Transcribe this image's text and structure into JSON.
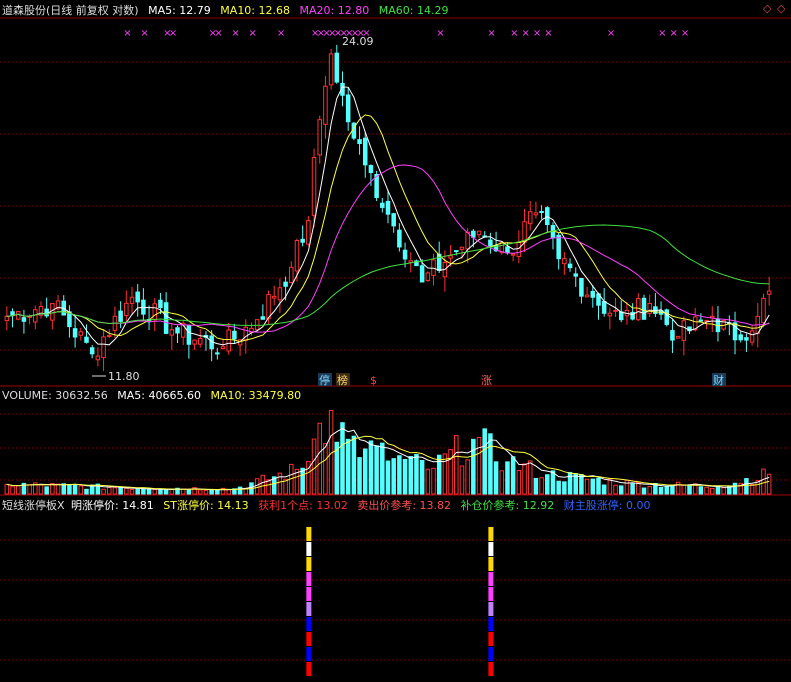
{
  "price_panel": {
    "stock_title": "道森股份(日线 前复权 对数)",
    "ma5_label": "MA5: 12.79",
    "ma10_label": "MA10: 12.68",
    "ma20_label": "MA20: 12.80",
    "ma60_label": "MA60: 14.29",
    "high_label": "24.09",
    "low_label": "11.80",
    "event_labels": [
      "停",
      "榜",
      "$",
      "涨",
      "财"
    ]
  },
  "volume_panel": {
    "volume_label": "VOLUME: 30632.56",
    "ma5_label": "MA5: 40665.60",
    "ma10_label": "MA10: 33479.80"
  },
  "indicator_panel": {
    "name_label": "短线涨停板X",
    "limit_up_label": "明涨停价: 14.81",
    "st_limit_label": "ST涨停价: 14.13",
    "profit_label": "获利1个点: 13.02",
    "sell_label": "卖出价参考: 13.82",
    "add_label": "补仓价参考: 12.92",
    "main_label": "财主股涨停: 0.00"
  },
  "controls": {
    "diamond_glyph": "◇",
    "close_glyph": "◇"
  },
  "colors": {
    "up": "#ff3030",
    "down": "#54ffff",
    "ma5": "#ffffff",
    "ma10": "#ffff40",
    "ma20": "#ff40ff",
    "ma60": "#40e040",
    "grid": "#8b0000",
    "text": "#dddddd"
  },
  "chart_data": {
    "type": "candlestick",
    "x_count": 135,
    "price_range": [
      11.3,
      25.5
    ],
    "price_scale": "log",
    "candles_key_points": [
      {
        "i": 0,
        "close": 12.9
      },
      {
        "i": 8,
        "close": 13.3
      },
      {
        "i": 15,
        "close": 11.8
      },
      {
        "i": 22,
        "close": 13.5
      },
      {
        "i": 30,
        "close": 12.4
      },
      {
        "i": 38,
        "close": 12.0
      },
      {
        "i": 44,
        "close": 12.8
      },
      {
        "i": 50,
        "close": 14.5
      },
      {
        "i": 53,
        "close": 16.2
      },
      {
        "i": 55,
        "close": 20.6
      },
      {
        "i": 57,
        "close": 24.09
      },
      {
        "i": 60,
        "close": 20.5
      },
      {
        "i": 63,
        "close": 18.5
      },
      {
        "i": 68,
        "close": 16.0
      },
      {
        "i": 73,
        "close": 14.0
      },
      {
        "i": 78,
        "close": 14.9
      },
      {
        "i": 83,
        "close": 15.8
      },
      {
        "i": 88,
        "close": 15.0
      },
      {
        "i": 93,
        "close": 16.5
      },
      {
        "i": 97,
        "close": 14.8
      },
      {
        "i": 103,
        "close": 13.5
      },
      {
        "i": 108,
        "close": 12.8
      },
      {
        "i": 113,
        "close": 13.3
      },
      {
        "i": 118,
        "close": 12.3
      },
      {
        "i": 124,
        "close": 12.9
      },
      {
        "i": 128,
        "close": 12.2
      },
      {
        "i": 132,
        "close": 12.9
      },
      {
        "i": 134,
        "close": 13.7
      }
    ],
    "volume_range": [
      0,
      140000
    ],
    "volume_key_points": [
      {
        "i": 0,
        "v": 15000
      },
      {
        "i": 20,
        "v": 10000
      },
      {
        "i": 40,
        "v": 8000
      },
      {
        "i": 52,
        "v": 40000
      },
      {
        "i": 55,
        "v": 110000
      },
      {
        "i": 57,
        "v": 130000
      },
      {
        "i": 60,
        "v": 85000
      },
      {
        "i": 63,
        "v": 70000
      },
      {
        "i": 68,
        "v": 55000
      },
      {
        "i": 75,
        "v": 40000
      },
      {
        "i": 82,
        "v": 85000
      },
      {
        "i": 88,
        "v": 50000
      },
      {
        "i": 95,
        "v": 30000
      },
      {
        "i": 110,
        "v": 16000
      },
      {
        "i": 125,
        "v": 12000
      },
      {
        "i": 134,
        "v": 30632.56
      }
    ],
    "indicator_bars": [
      {
        "i": 53,
        "segments": [
          "#ffd800",
          "#ffffff",
          "#ffd800",
          "#ff40ff",
          "#ff40ff",
          "#c080ff",
          "#0000ff",
          "#ff0000",
          "#0000ff",
          "#ff0000"
        ]
      },
      {
        "i": 85,
        "segments": [
          "#ffd800",
          "#ffffff",
          "#ffd800",
          "#ff40ff",
          "#ff40ff",
          "#c080ff",
          "#0000ff",
          "#ff0000",
          "#0000ff",
          "#ff0000"
        ]
      }
    ],
    "marker_positions": [
      21,
      24,
      28,
      29,
      36,
      37,
      40,
      43,
      48,
      54,
      55,
      56,
      57,
      58,
      59,
      60,
      61,
      62,
      63,
      76,
      85,
      89,
      91,
      93,
      95,
      106,
      115,
      117,
      119
    ]
  }
}
